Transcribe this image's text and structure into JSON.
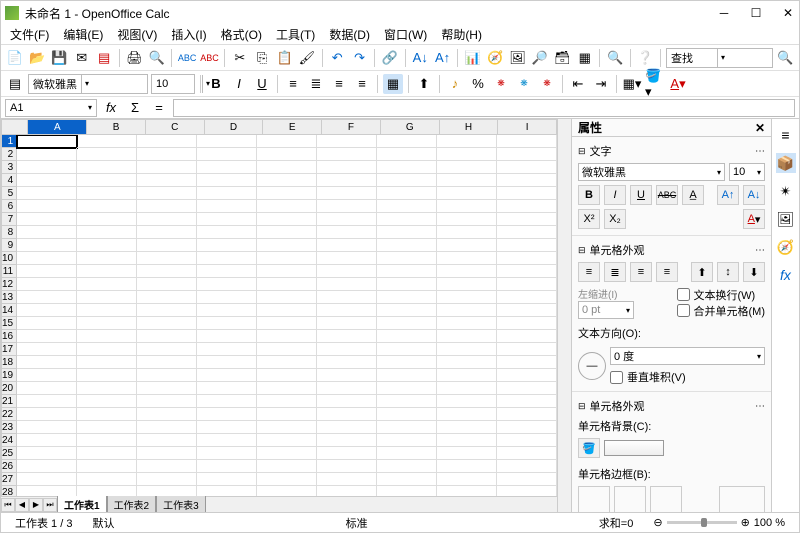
{
  "title": "未命名 1 - OpenOffice Calc",
  "menu": [
    "文件(F)",
    "编辑(E)",
    "视图(V)",
    "插入(I)",
    "格式(O)",
    "工具(T)",
    "数据(D)",
    "窗口(W)",
    "帮助(H)"
  ],
  "search_label": "查找",
  "font_name": "微软雅黑",
  "font_size": "10",
  "cell_ref": "A1",
  "columns": [
    "A",
    "B",
    "C",
    "D",
    "E",
    "F",
    "G",
    "H",
    "I"
  ],
  "row_count": 30,
  "tabs": [
    "工作表1",
    "工作表2",
    "工作表3"
  ],
  "sidebar": {
    "title": "属性",
    "text_section": "文字",
    "font": "微软雅黑",
    "size": "10",
    "cell_appearance": "单元格外观",
    "indent_label": "左缩进(I)",
    "indent_value": "0 pt",
    "wrap_label": "文本换行(W)",
    "merge_label": "合并单元格(M)",
    "orient_label": "文本方向(O):",
    "orient_value": "0 度",
    "vstack_label": "垂直堆积(V)",
    "cell_appearance2": "单元格外观",
    "bg_label": "单元格背景(C):",
    "border_label": "单元格边框(B):"
  },
  "status": {
    "sheet": "工作表 1 / 3",
    "mode": "默认",
    "std": "标准",
    "sum": "求和=0",
    "zoom": "100 %"
  }
}
